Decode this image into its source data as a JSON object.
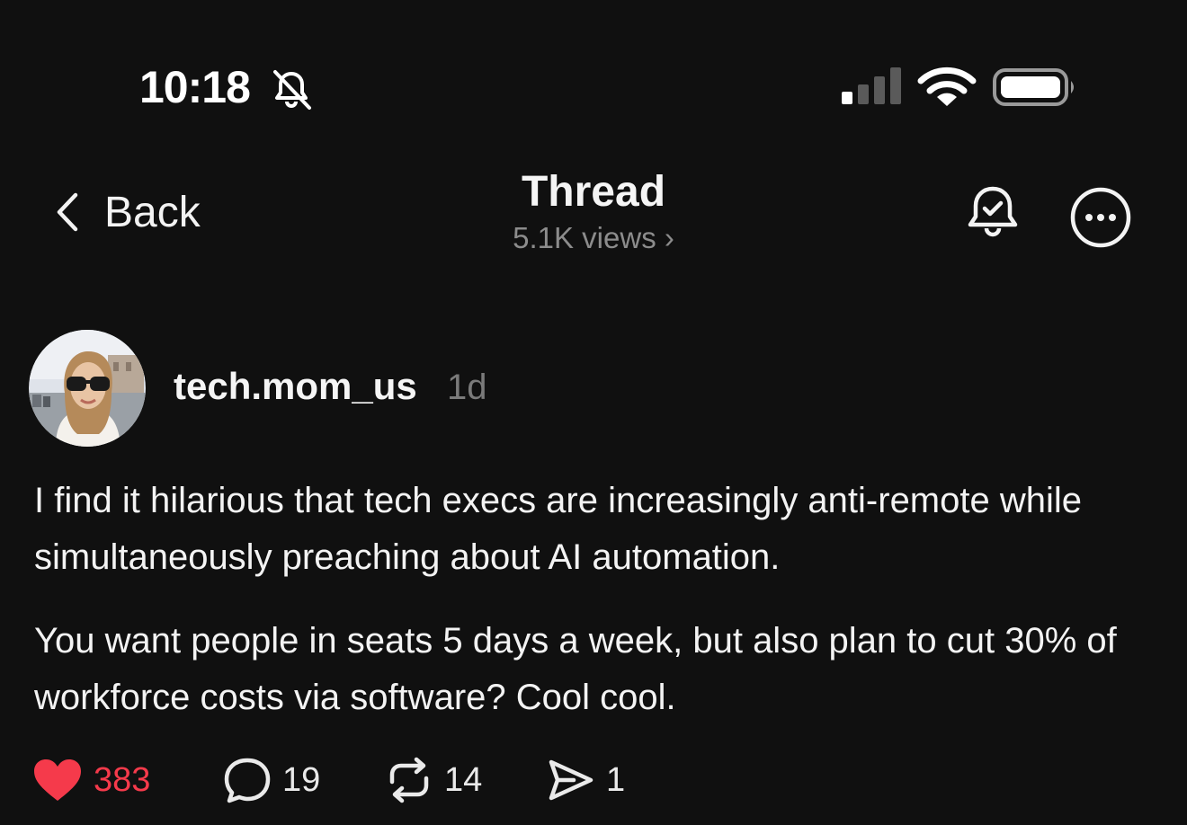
{
  "status_bar": {
    "time": "10:18",
    "icons": [
      "bell-slash-icon",
      "cellular-signal-icon",
      "wifi-icon",
      "battery-icon"
    ]
  },
  "nav": {
    "back_label": "Back",
    "title": "Thread",
    "subtitle": "5.1K views",
    "actions": [
      "bell-check-icon",
      "more-icon"
    ]
  },
  "post": {
    "author": "tech.mom_us",
    "time_ago": "1d",
    "paragraphs": [
      "I find it hilarious that tech execs are increasingly anti-remote while simultaneously preaching about AI automation.",
      "You want people in seats 5 days a week, but also plan to cut 30% of workforce costs via software? Cool cool."
    ],
    "stats": {
      "likes": "383",
      "replies": "19",
      "reposts": "14",
      "shares": "1"
    }
  },
  "colors": {
    "background": "#101010",
    "text": "#f3f3f3",
    "secondary_text": "#8c8c8c",
    "like_red": "#f53a4b"
  }
}
